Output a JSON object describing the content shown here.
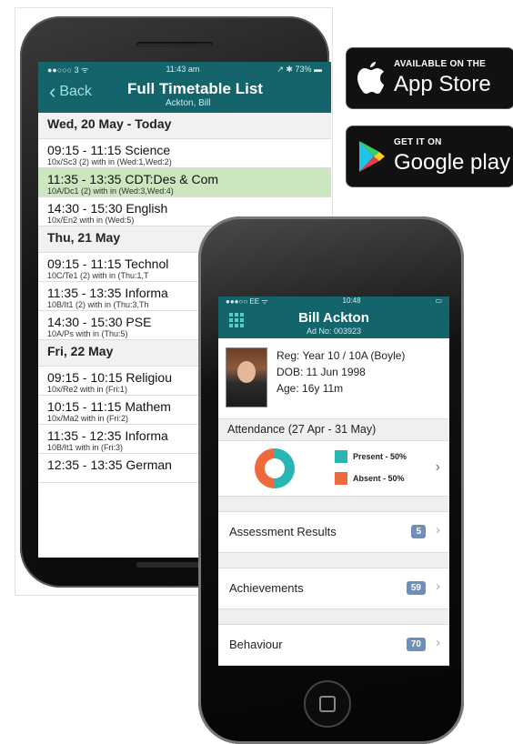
{
  "android": {
    "status": {
      "left": "●●○○○ 3 ᯤ",
      "time": "11:43 am",
      "right": "↗ ✱ 73% ▬"
    },
    "nav": {
      "back": "Back",
      "title": "Full Timetable List",
      "subtitle": "Ackton, Bill"
    },
    "days": [
      {
        "heading": "Wed, 20 May - Today",
        "rows": [
          {
            "time": "09:15 - 11:15  Science",
            "detail": "10x/Sc3 (2) with   in    (Wed:1,Wed:2)"
          },
          {
            "time": "11:35 - 13:35  CDT:Des & Com",
            "detail": "10A/Dc1 (2) with   in    (Wed:3,Wed:4)"
          },
          {
            "time": "14:30 - 15:30  English",
            "detail": "10x/En2 with   in    (Wed:5)"
          }
        ]
      },
      {
        "heading": "Thu, 21 May",
        "rows": [
          {
            "time": "09:15 - 11:15  Technol",
            "detail": "10C/Te1 (2) with   in    (Thu:1,T"
          },
          {
            "time": "11:35 - 13:35  Informa",
            "detail": "10B/It1 (2) with   in    (Thu:3,Th"
          },
          {
            "time": "14:30 - 15:30  PSE",
            "detail": "10A/Ps with   in    (Thu:5)"
          }
        ]
      },
      {
        "heading": "Fri, 22 May",
        "rows": [
          {
            "time": "09:15 - 10:15  Religiou",
            "detail": "10x/Re2 with   in    (Fri:1)"
          },
          {
            "time": "10:15 - 11:15  Mathem",
            "detail": "10x/Ma2 with   in    (Fri:2)"
          },
          {
            "time": "11:35 - 12:35  Informa",
            "detail": "10B/It1 with   in    (Fri:3)"
          },
          {
            "time": "12:35 - 13:35  German",
            "detail": ""
          }
        ]
      }
    ]
  },
  "badges": {
    "appstore": {
      "small": "AVAILABLE ON THE",
      "big": "App Store"
    },
    "googleplay": {
      "small": "GET IT ON",
      "big": "Google play"
    }
  },
  "iphone": {
    "status": {
      "left": "●●●○○ EE ᯤ",
      "time": "10:48",
      "right": "▭"
    },
    "nav": {
      "name": "Bill Ackton",
      "adno": "Ad No: 003923"
    },
    "profile": {
      "reg": "Reg: Year 10 / 10A  (Boyle)",
      "dob": "DOB: 11 Jun 1998",
      "age": "Age: 16y 11m"
    },
    "attendance": {
      "heading": "Attendance (27 Apr - 31 May)",
      "present_label": "Present - 50%",
      "absent_label": "Absent - 50%",
      "present_pct": 50,
      "absent_pct": 50,
      "present_color": "#29b6b3",
      "absent_color": "#ee6a3d"
    },
    "rows": [
      {
        "label": "Assessment Results",
        "count": "5"
      },
      {
        "label": "Achievements",
        "count": "59"
      },
      {
        "label": "Behaviour",
        "count": "70"
      }
    ]
  }
}
